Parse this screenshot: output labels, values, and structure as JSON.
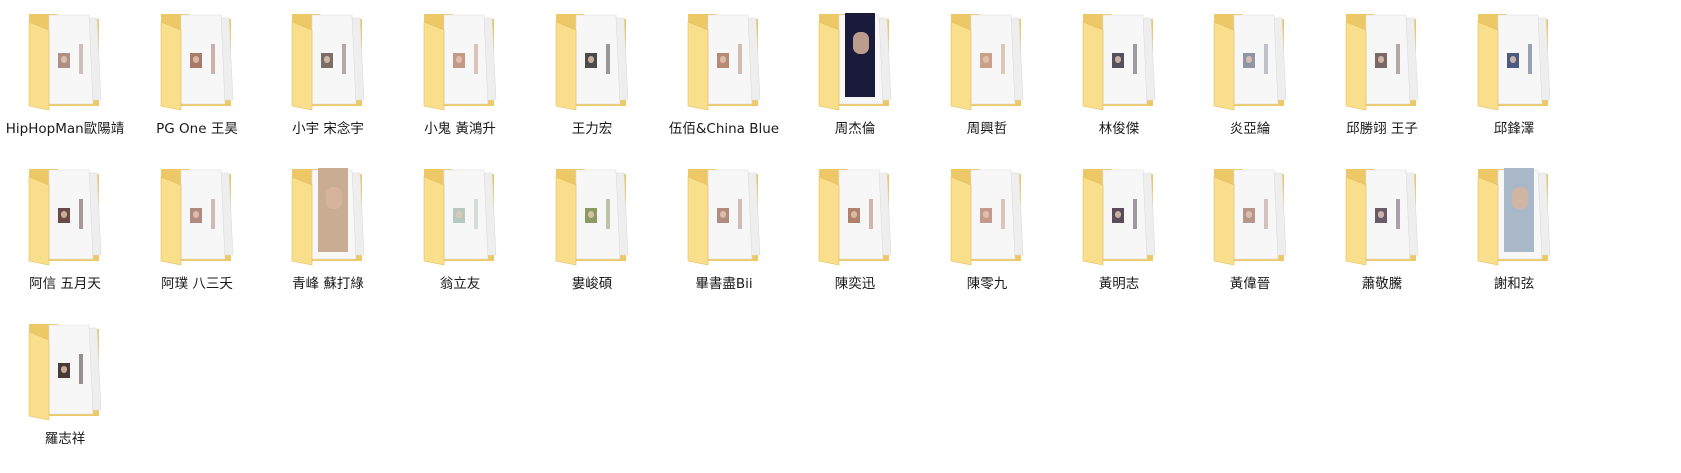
{
  "window": {
    "view_mode": "large-icons"
  },
  "colors": {
    "folder_back": "#EDC867",
    "folder_front": "#F9DE8B",
    "folder_front_edge": "#E6BF5E",
    "paper": "#F7F7F7",
    "paper_back": "#EEEEEE",
    "label_text": "#1A1A1A"
  },
  "folders": [
    {
      "name": "HipHopMan歐陽靖",
      "icon": "folder-icon",
      "thumb": "small-portrait",
      "thumb_tint": "#b08f86"
    },
    {
      "name": "PG One 王昊",
      "icon": "folder-icon",
      "thumb": "small-portrait",
      "thumb_tint": "#a87a68"
    },
    {
      "name": "小宇 宋念宇",
      "icon": "folder-icon",
      "thumb": "small-portrait",
      "thumb_tint": "#7d6d68"
    },
    {
      "name": "小鬼 黃鴻升",
      "icon": "folder-icon",
      "thumb": "small-portrait",
      "thumb_tint": "#c29a86"
    },
    {
      "name": "王力宏",
      "icon": "folder-icon",
      "thumb": "small-portrait",
      "thumb_tint": "#4e4a49"
    },
    {
      "name": "伍佰&China Blue",
      "icon": "folder-icon",
      "thumb": "small-portrait",
      "thumb_tint": "#b88a74"
    },
    {
      "name": "周杰倫",
      "icon": "folder-icon",
      "thumb": "large-portrait",
      "thumb_tint": "#1a1a3a"
    },
    {
      "name": "周興哲",
      "icon": "folder-icon",
      "thumb": "small-portrait",
      "thumb_tint": "#c9a08a"
    },
    {
      "name": "林俊傑",
      "icon": "folder-icon",
      "thumb": "small-portrait",
      "thumb_tint": "#55505c"
    },
    {
      "name": "炎亞綸",
      "icon": "folder-icon",
      "thumb": "small-portrait",
      "thumb_tint": "#8f96a6"
    },
    {
      "name": "邱勝翊 王子",
      "icon": "folder-icon",
      "thumb": "small-portrait",
      "thumb_tint": "#7a6a66"
    },
    {
      "name": "邱鋒澤",
      "icon": "folder-icon",
      "thumb": "small-portrait",
      "thumb_tint": "#4a5a80"
    },
    {
      "name": "阿信 五月天",
      "icon": "folder-icon",
      "thumb": "small-portrait",
      "thumb_tint": "#6a4a44"
    },
    {
      "name": "阿璞 八三夭",
      "icon": "folder-icon",
      "thumb": "small-portrait",
      "thumb_tint": "#b08a80"
    },
    {
      "name": "青峰 蘇打綠",
      "icon": "folder-icon",
      "thumb": "large-portrait",
      "thumb_tint": "#c9ad92"
    },
    {
      "name": "翁立友",
      "icon": "folder-icon",
      "thumb": "small-portrait",
      "thumb_tint": "#b7c8c0"
    },
    {
      "name": "婁峻碩",
      "icon": "folder-icon",
      "thumb": "small-portrait",
      "thumb_tint": "#8a9a62"
    },
    {
      "name": "畢書盡Bii",
      "icon": "folder-icon",
      "thumb": "small-portrait",
      "thumb_tint": "#b38a80"
    },
    {
      "name": "陳奕迅",
      "icon": "folder-icon",
      "thumb": "small-portrait",
      "thumb_tint": "#b0826c"
    },
    {
      "name": "陳零九",
      "icon": "folder-icon",
      "thumb": "small-portrait",
      "thumb_tint": "#c49a8c"
    },
    {
      "name": "黃明志",
      "icon": "folder-icon",
      "thumb": "small-portrait",
      "thumb_tint": "#5a4a5a"
    },
    {
      "name": "黃偉晉",
      "icon": "folder-icon",
      "thumb": "small-portrait",
      "thumb_tint": "#b6978a"
    },
    {
      "name": "蕭敬騰",
      "icon": "folder-icon",
      "thumb": "small-portrait",
      "thumb_tint": "#6a5a6a"
    },
    {
      "name": "謝和弦",
      "icon": "folder-icon",
      "thumb": "large-portrait",
      "thumb_tint": "#a8b8c8"
    },
    {
      "name": "羅志祥",
      "icon": "folder-icon",
      "thumb": "small-portrait",
      "thumb_tint": "#4a3a36"
    }
  ]
}
